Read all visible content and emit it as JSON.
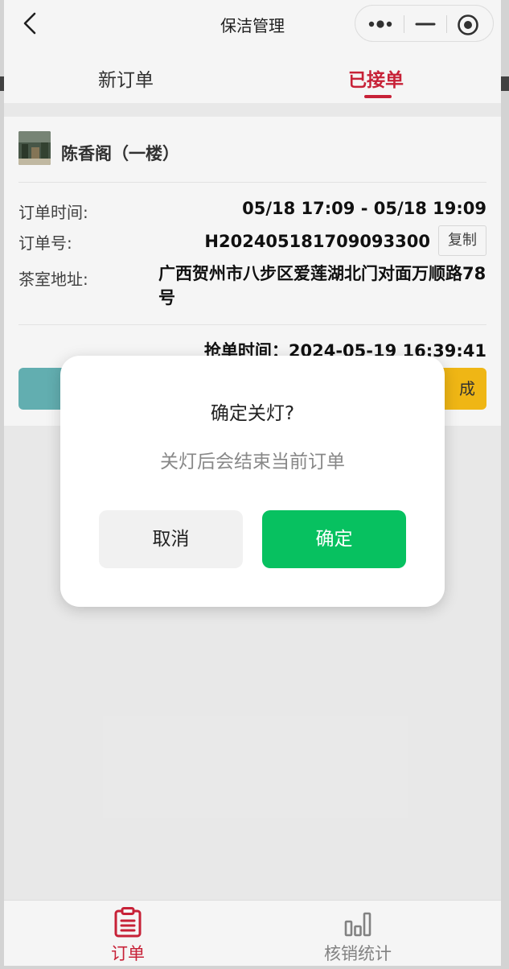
{
  "navbar": {
    "title": "保洁管理"
  },
  "tabs": {
    "new_orders": "新订单",
    "accepted": "已接单"
  },
  "order": {
    "shop_name": "陈香阁（一楼）",
    "time_label": "订单时间:",
    "time_value": "05/18 17:09 - 05/18 19:09",
    "number_label": "订单号:",
    "number_value": "H202405181709093300",
    "copy_label": "复制",
    "address_label": "茶室地址:",
    "address_value": "广西贺州市八步区爱莲湖北门对面万顺路78号",
    "grab_time": "抢单时间：2024-05-19 16:39:41",
    "right_button_fragment": "成"
  },
  "dialog": {
    "title": "确定关灯?",
    "message": "关灯后会结束当前订单",
    "cancel": "取消",
    "confirm": "确定"
  },
  "tabbar": {
    "orders": "订单",
    "stats": "核销统计"
  },
  "icons": {
    "back": "chevron-left-icon",
    "more": "more-dots-icon",
    "minimize": "minimize-icon",
    "target": "target-icon",
    "orders": "clipboard-icon",
    "stats": "bar-chart-icon"
  },
  "colors": {
    "accent_red": "#d0233a",
    "confirm_green": "#07c160",
    "teal_button": "#67b6b8",
    "yellow_button": "#f9be16"
  }
}
